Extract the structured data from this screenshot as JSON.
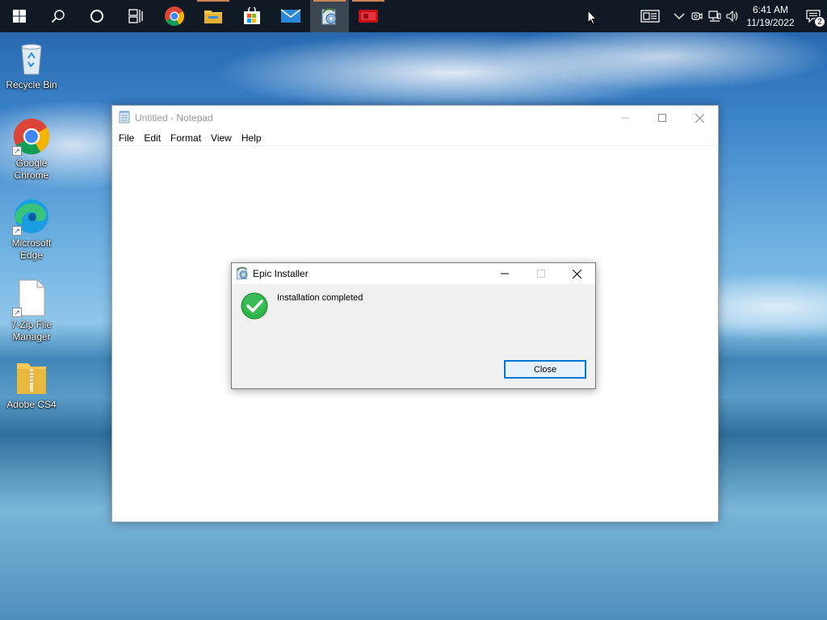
{
  "taskbar": {
    "apps": [
      {
        "name": "start-button",
        "icon": "windows-logo-icon"
      },
      {
        "name": "search-button",
        "icon": "search-icon"
      },
      {
        "name": "cortana-button",
        "icon": "cortana-icon"
      },
      {
        "name": "task-view-button",
        "icon": "task-view-icon"
      },
      {
        "name": "chrome-button",
        "icon": "chrome-icon"
      },
      {
        "name": "file-explorer-button",
        "icon": "folder-icon"
      },
      {
        "name": "store-button",
        "icon": "store-icon"
      },
      {
        "name": "mail-button",
        "icon": "mail-icon"
      },
      {
        "name": "installer-button",
        "icon": "installer-icon"
      },
      {
        "name": "red-app-button",
        "icon": "red-app-icon"
      }
    ],
    "clock": {
      "time": "6:41 AM",
      "date": "11/19/2022"
    },
    "notification_count": "2"
  },
  "desktop": {
    "icons": [
      {
        "label": "Recycle Bin"
      },
      {
        "label": "Google Chrome"
      },
      {
        "label": "Microsoft Edge"
      },
      {
        "label": "7-Zip File Manager"
      },
      {
        "label": "Adobe CS4"
      }
    ]
  },
  "notepad": {
    "title": "Untitled - Notepad",
    "menu": [
      "File",
      "Edit",
      "Format",
      "View",
      "Help"
    ],
    "content": ""
  },
  "dialog": {
    "title": "Epic Installer",
    "message": "Installation completed",
    "close_label": "Close"
  },
  "colors": {
    "accent": "#0078d7",
    "taskbar": "#0f1a24",
    "success": "#2db34a"
  }
}
